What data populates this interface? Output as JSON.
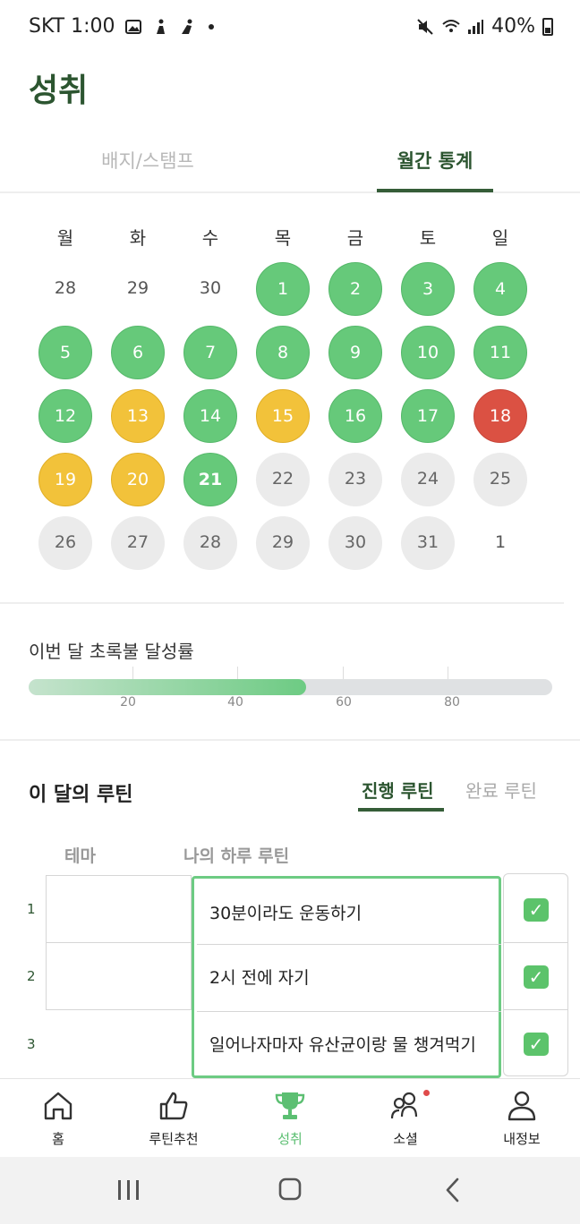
{
  "status_bar": {
    "carrier_time": "SKT 1:00",
    "battery": "40%",
    "icons_left": [
      "image-icon",
      "figure-icon",
      "figure-icon-2"
    ],
    "icons_right": [
      "mute-icon",
      "wifi-icon",
      "signal-icon",
      "battery-icon"
    ]
  },
  "header": {
    "title": "성취"
  },
  "tabs": [
    {
      "label": "배지/스탬프",
      "active": false
    },
    {
      "label": "월간 통계",
      "active": true
    }
  ],
  "calendar": {
    "weekdays": [
      "월",
      "화",
      "수",
      "목",
      "금",
      "토",
      "일"
    ],
    "weeks": [
      [
        {
          "d": "28",
          "s": "none"
        },
        {
          "d": "29",
          "s": "none"
        },
        {
          "d": "30",
          "s": "none"
        },
        {
          "d": "1",
          "s": "green"
        },
        {
          "d": "2",
          "s": "green"
        },
        {
          "d": "3",
          "s": "green"
        },
        {
          "d": "4",
          "s": "green"
        }
      ],
      [
        {
          "d": "5",
          "s": "green"
        },
        {
          "d": "6",
          "s": "green"
        },
        {
          "d": "7",
          "s": "green"
        },
        {
          "d": "8",
          "s": "green"
        },
        {
          "d": "9",
          "s": "green"
        },
        {
          "d": "10",
          "s": "green"
        },
        {
          "d": "11",
          "s": "green"
        }
      ],
      [
        {
          "d": "12",
          "s": "green"
        },
        {
          "d": "13",
          "s": "yellow"
        },
        {
          "d": "14",
          "s": "green"
        },
        {
          "d": "15",
          "s": "yellow"
        },
        {
          "d": "16",
          "s": "green"
        },
        {
          "d": "17",
          "s": "green"
        },
        {
          "d": "18",
          "s": "red"
        }
      ],
      [
        {
          "d": "19",
          "s": "yellow"
        },
        {
          "d": "20",
          "s": "yellow"
        },
        {
          "d": "21",
          "s": "green",
          "today": true
        },
        {
          "d": "22",
          "s": "gray"
        },
        {
          "d": "23",
          "s": "gray"
        },
        {
          "d": "24",
          "s": "gray"
        },
        {
          "d": "25",
          "s": "gray"
        }
      ],
      [
        {
          "d": "26",
          "s": "gray"
        },
        {
          "d": "27",
          "s": "gray"
        },
        {
          "d": "28",
          "s": "gray"
        },
        {
          "d": "29",
          "s": "gray"
        },
        {
          "d": "30",
          "s": "gray"
        },
        {
          "d": "31",
          "s": "gray"
        },
        {
          "d": "1",
          "s": "none"
        }
      ]
    ]
  },
  "progress": {
    "title": "이번 달 초록불 달성률",
    "value_percent": 53,
    "ticks": [
      "20",
      "40",
      "60",
      "80"
    ],
    "colors": {
      "fill_start": "#c5e3cd",
      "fill_end": "#6dcb83",
      "track": "#dfe1e3"
    }
  },
  "routines": {
    "title": "이 달의 루틴",
    "tabs": [
      {
        "label": "진행 루틴",
        "active": true
      },
      {
        "label": "완료 루틴",
        "active": false
      }
    ],
    "columns": {
      "theme": "테마",
      "routine": "나의 하루 루틴"
    },
    "rows": [
      {
        "num": "1",
        "theme": "",
        "routine": "30분이라도 운동하기",
        "checked": true
      },
      {
        "num": "2",
        "theme": "",
        "routine": "2시 전에 자기",
        "checked": true
      },
      {
        "num": "3",
        "theme": "",
        "routine": "일어나자마자 유산균이랑 물 챙겨먹기",
        "checked": true
      }
    ]
  },
  "bottom_nav": [
    {
      "label": "홈",
      "icon": "home-icon",
      "active": false
    },
    {
      "label": "루틴추천",
      "icon": "thumbs-up-icon",
      "active": false
    },
    {
      "label": "성취",
      "icon": "trophy-icon",
      "active": true
    },
    {
      "label": "소셜",
      "icon": "people-icon",
      "active": false,
      "has_badge": true
    },
    {
      "label": "내정보",
      "icon": "person-icon",
      "active": false
    }
  ],
  "colors": {
    "brand_dark_green": "#2c5530",
    "green": "#66c97a",
    "yellow": "#f2c23a",
    "red": "#db5143",
    "gray": "#ebebeb",
    "nav_active": "#5cbf72"
  }
}
